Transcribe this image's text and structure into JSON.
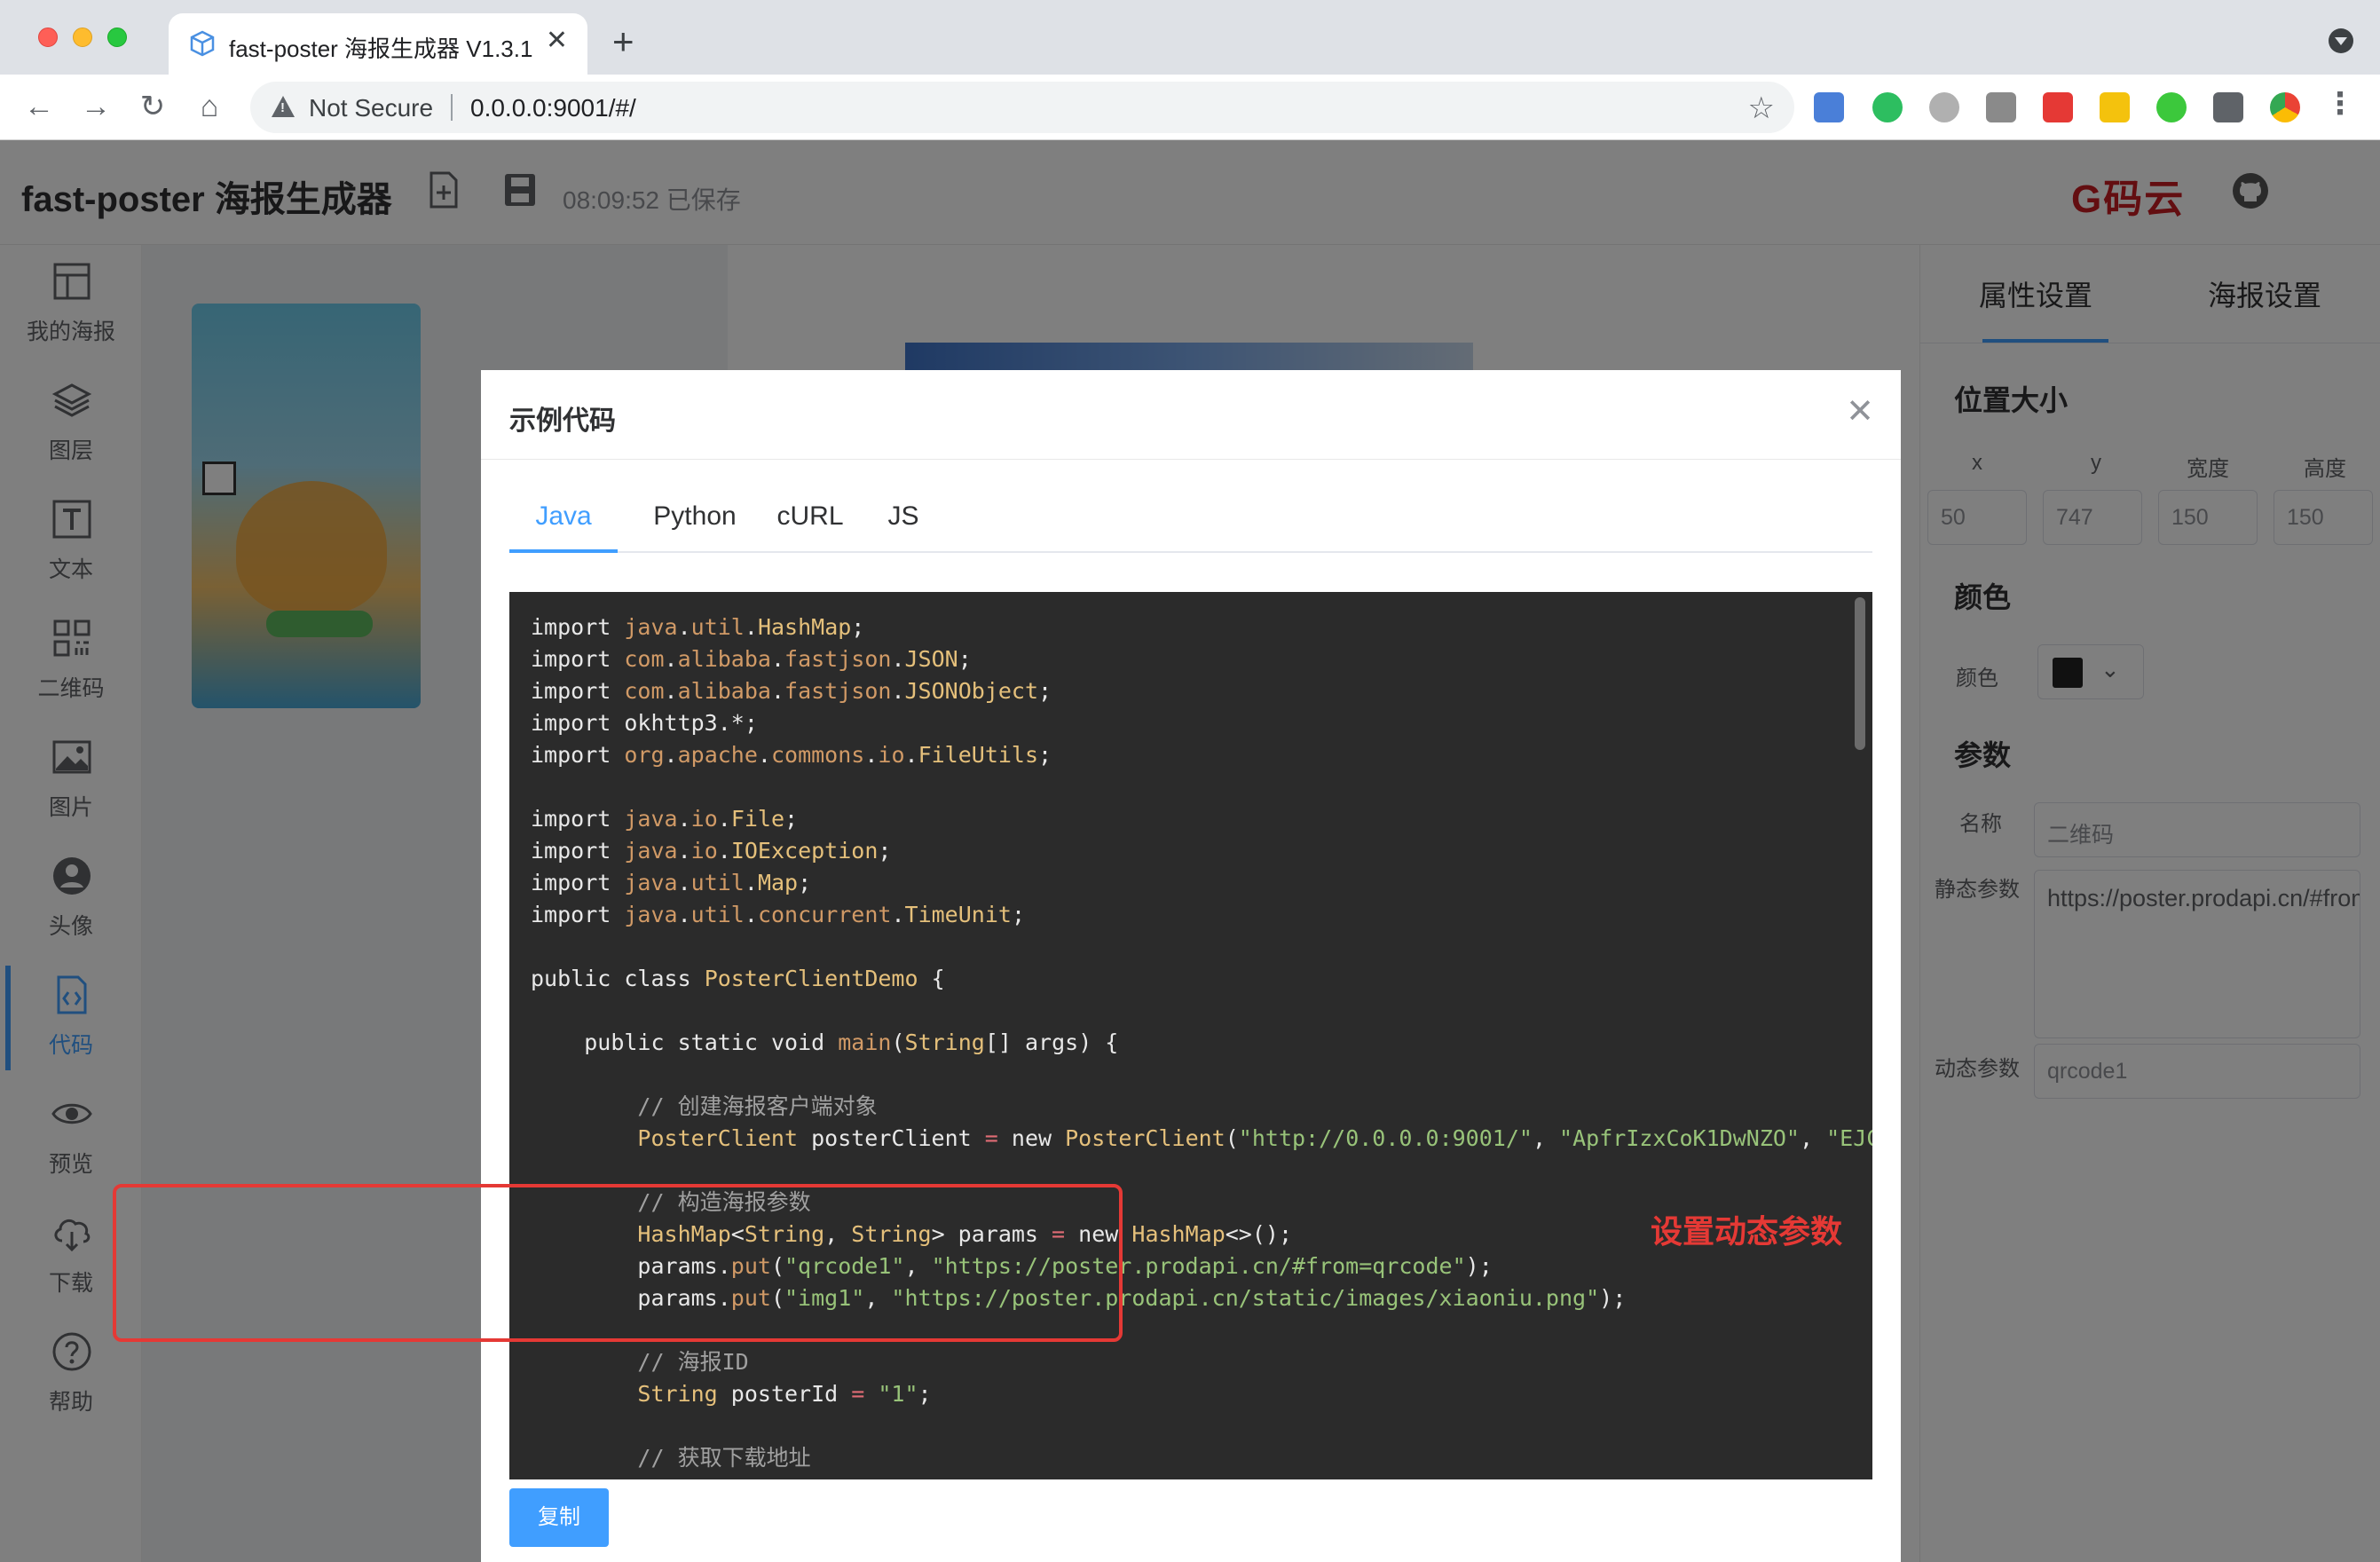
{
  "browser": {
    "tab_title": "fast-poster 海报生成器 V1.3.1",
    "security_label": "Not Secure",
    "url": "0.0.0.0:9001/#/"
  },
  "app": {
    "title": "fast-poster 海报生成器",
    "save_status": "08:09:52 已保存",
    "gitee_label": "码云"
  },
  "sidebar": {
    "items": [
      {
        "label": "我的海报",
        "icon": "layout-icon"
      },
      {
        "label": "图层",
        "icon": "layers-icon"
      },
      {
        "label": "文本",
        "icon": "text-icon"
      },
      {
        "label": "二维码",
        "icon": "qrcode-icon"
      },
      {
        "label": "图片",
        "icon": "image-icon"
      },
      {
        "label": "头像",
        "icon": "avatar-icon"
      },
      {
        "label": "代码",
        "icon": "code-icon"
      },
      {
        "label": "预览",
        "icon": "eye-icon"
      },
      {
        "label": "下载",
        "icon": "download-icon"
      },
      {
        "label": "帮助",
        "icon": "help-icon"
      }
    ]
  },
  "right_panel": {
    "tabs": [
      "属性设置",
      "海报设置"
    ],
    "position_section": "位置大小",
    "position_labels": [
      "x",
      "y",
      "宽度",
      "高度"
    ],
    "position_values": [
      "50",
      "747",
      "150",
      "150"
    ],
    "color_section": "颜色",
    "color_label": "颜色",
    "color_value": "#222222",
    "params_section": "参数",
    "name_label": "名称",
    "name_value": "二维码",
    "static_label": "静态参数",
    "static_value": "https://poster.prodapi.cn/#from=qrcode",
    "dynamic_label": "动态参数",
    "dynamic_value": "qrcode1"
  },
  "dialog": {
    "title": "示例代码",
    "tabs": [
      "Java",
      "Python",
      "cURL",
      "JS"
    ],
    "active_tab": "Java",
    "copy_button": "复制",
    "annotation": "设置动态参数",
    "code_lines": [
      "import java.util.HashMap;",
      "import com.alibaba.fastjson.JSON;",
      "import com.alibaba.fastjson.JSONObject;",
      "import okhttp3.*;",
      "import org.apache.commons.io.FileUtils;",
      "",
      "import java.io.File;",
      "import java.io.IOException;",
      "import java.util.Map;",
      "import java.util.concurrent.TimeUnit;",
      "",
      "public class PosterClientDemo {",
      "",
      "    public static void main(String[] args) {",
      "",
      "        // 创建海报客户端对象",
      "        PosterClient posterClient = new PosterClient(\"http://0.0.0.0:9001/\", \"ApfrIzxCoK1DwNZO\", \"EJCwlrn",
      "",
      "        // 构造海报参数",
      "        HashMap<String, String> params = new HashMap<>();",
      "        params.put(\"qrcode1\", \"https://poster.prodapi.cn/#from=qrcode\");",
      "        params.put(\"img1\", \"https://poster.prodapi.cn/static/images/xiaoniu.png\");",
      "",
      "        // 海报ID",
      "        String posterId = \"1\";",
      "",
      "        // 获取下载地址"
    ]
  },
  "colors": {
    "accent": "#409eff",
    "annotation_red": "#e53935",
    "code_bg": "#2b2b2b"
  }
}
